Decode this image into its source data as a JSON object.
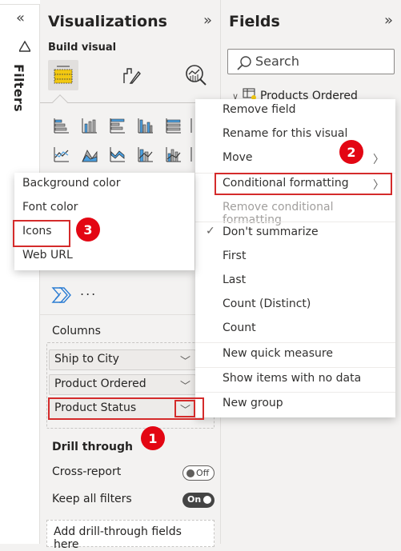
{
  "filters_pane": {
    "label": "Filters",
    "collapse_icon": "«",
    "filter_icon": "funnel-icon"
  },
  "visualizations": {
    "title": "Visualizations",
    "expand_icon": "»",
    "build_visual_label": "Build visual",
    "build_tabs": [
      "build-visual-table-icon",
      "format-visual-icon",
      "analytics-icon"
    ],
    "more_label": "...",
    "columns_label": "Columns",
    "columns": [
      {
        "label": "Ship to City"
      },
      {
        "label": "Product Ordered"
      },
      {
        "label": "Product Status"
      }
    ],
    "drill_through": {
      "title": "Drill through",
      "cross_report_label": "Cross-report",
      "cross_report_state": "Off",
      "keep_filters_label": "Keep all filters",
      "keep_filters_state": "On",
      "add_fields_placeholder": "Add drill-through fields here"
    }
  },
  "fields": {
    "title": "Fields",
    "expand_icon": "»",
    "search_placeholder": "Search",
    "tree": [
      {
        "label": "Products Ordered",
        "expanded": true
      }
    ]
  },
  "context_menu": {
    "items": [
      {
        "label": "Remove field"
      },
      {
        "label": "Rename for this visual"
      },
      {
        "label": "Move",
        "submenu": true
      },
      {
        "label": "Conditional formatting",
        "submenu": true,
        "highlighted": true
      },
      {
        "label": "Remove conditional formatting",
        "disabled": true
      },
      {
        "label": "Don't summarize",
        "checked": true
      },
      {
        "label": "First"
      },
      {
        "label": "Last"
      },
      {
        "label": "Count (Distinct)"
      },
      {
        "label": "Count"
      },
      {
        "label": "New quick measure"
      },
      {
        "label": "Show items with no data"
      },
      {
        "label": "New group"
      }
    ]
  },
  "submenu": {
    "items": [
      {
        "label": "Background color"
      },
      {
        "label": "Font color"
      },
      {
        "label": "Icons",
        "highlighted": true
      },
      {
        "label": "Web URL"
      }
    ]
  },
  "annotations": [
    {
      "number": "1"
    },
    {
      "number": "2"
    },
    {
      "number": "3"
    }
  ],
  "colors": {
    "accent_yellow": "#f2c811",
    "annotation_red": "#e30613",
    "highlight_border": "#d42b2b",
    "visual_blue": "#4a9fe0"
  }
}
